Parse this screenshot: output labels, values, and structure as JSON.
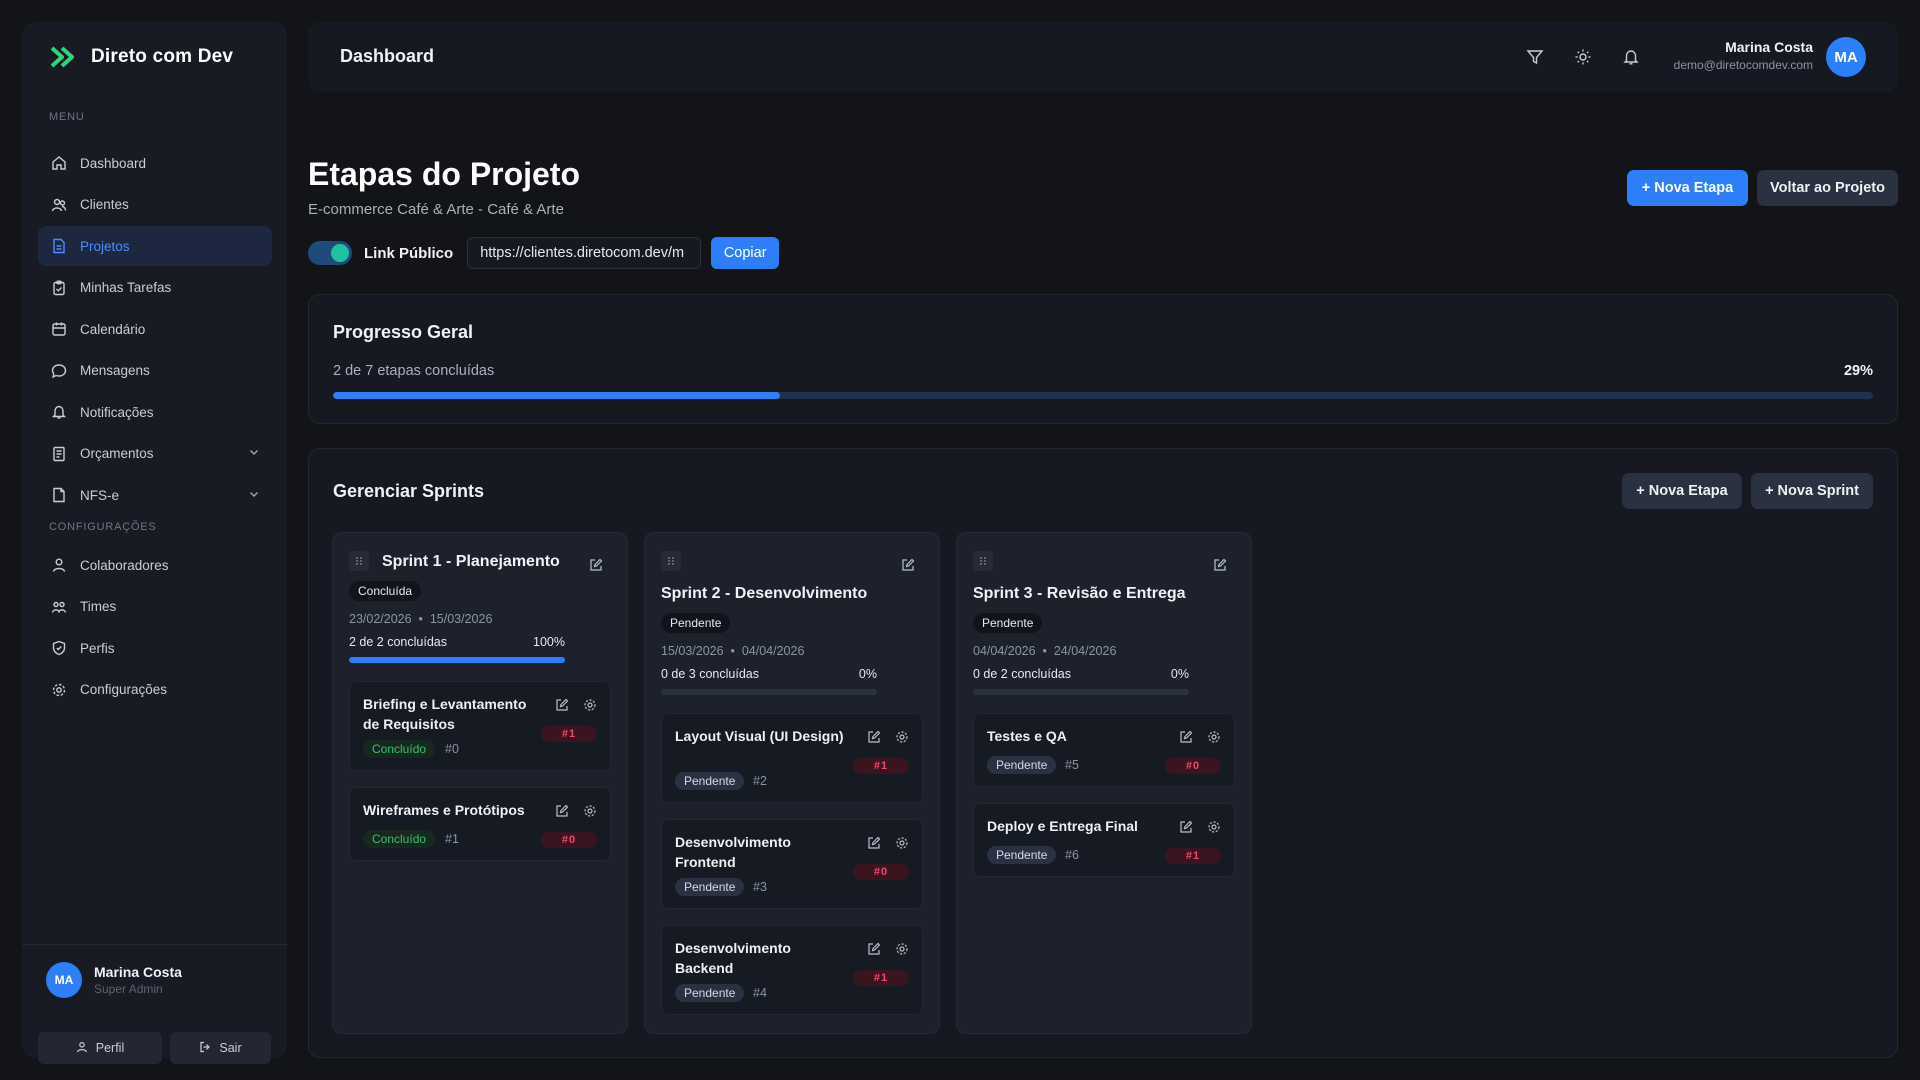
{
  "brand": {
    "name": "Direto com Dev",
    "logo_icon": "double-chevron-logo",
    "accent": "#2bd67b"
  },
  "sidebar": {
    "menu_label": "MENU",
    "items": [
      {
        "label": "Dashboard",
        "icon": "home-icon"
      },
      {
        "label": "Clientes",
        "icon": "users-icon"
      },
      {
        "label": "Projetos",
        "icon": "document-icon",
        "active": true
      },
      {
        "label": "Minhas Tarefas",
        "icon": "clipboard-icon"
      },
      {
        "label": "Calendário",
        "icon": "calendar-icon"
      },
      {
        "label": "Mensagens",
        "icon": "message-icon"
      },
      {
        "label": "Notificações",
        "icon": "bell-icon"
      },
      {
        "label": "Orçamentos",
        "icon": "receipt-icon",
        "expandable": true
      },
      {
        "label": "NFS-e",
        "icon": "file-icon",
        "expandable": true
      }
    ],
    "config_label": "CONFIGURAÇÕES",
    "config_items": [
      {
        "label": "Colaboradores",
        "icon": "user-group-icon"
      },
      {
        "label": "Times",
        "icon": "team-icon"
      },
      {
        "label": "Perfis",
        "icon": "shield-icon"
      },
      {
        "label": "Configurações",
        "icon": "gear-icon"
      }
    ],
    "user": {
      "initials": "MA",
      "name": "Marina Costa",
      "role": "Super Admin"
    },
    "profile_button": "Perfil",
    "logout_button": "Sair"
  },
  "topbar": {
    "title": "Dashboard",
    "user_name": "Marina Costa",
    "user_email": "demo@diretocomdev.com",
    "user_initials": "MA"
  },
  "page": {
    "title": "Etapas do Projeto",
    "subtitle": "E-commerce Café & Arte - Café & Arte",
    "new_stage_button": "+ Nova Etapa",
    "back_button": "Voltar ao Projeto",
    "public_link_label": "Link Público",
    "public_link_value": "https://clientes.diretocom.dev/m",
    "copy_button": "Copiar",
    "public_link_enabled": true
  },
  "progress": {
    "title": "Progresso Geral",
    "summary": "2 de 7 etapas concluídas",
    "percent_label": "29%",
    "fraction": 0.29
  },
  "sprints_section": {
    "title": "Gerenciar Sprints",
    "new_stage_button": "+ Nova Etapa",
    "new_sprint_button": "+ Nova Sprint"
  },
  "sprints": [
    {
      "title": "Sprint 1 - Planejamento",
      "status": "Concluída",
      "start": "23/02/2026",
      "end": "15/03/2026",
      "progress_text": "2 de 2 concluídas",
      "progress_percent": "100%",
      "fraction": 1.0,
      "tasks": [
        {
          "title": "Briefing e Levantamento de Requisitos",
          "status": "Concluído",
          "status_kind": "done",
          "num": "#0",
          "priority": "#1"
        },
        {
          "title": "Wireframes e Protótipos",
          "status": "Concluído",
          "status_kind": "done",
          "num": "#1",
          "priority": "#0"
        }
      ]
    },
    {
      "title": "Sprint 2 - Desenvolvimento",
      "status": "Pendente",
      "start": "15/03/2026",
      "end": "04/04/2026",
      "progress_text": "0 de 3 concluídas",
      "progress_percent": "0%",
      "fraction": 0.0,
      "tasks": [
        {
          "title": "Layout Visual (UI Design)",
          "status": "Pendente",
          "status_kind": "pending",
          "num": "#2",
          "priority": "#1"
        },
        {
          "title": "Desenvolvimento Frontend",
          "status": "Pendente",
          "status_kind": "pending",
          "num": "#3",
          "priority": "#0"
        },
        {
          "title": "Desenvolvimento Backend",
          "status": "Pendente",
          "status_kind": "pending",
          "num": "#4",
          "priority": "#1"
        }
      ]
    },
    {
      "title": "Sprint 3 - Revisão e Entrega",
      "status": "Pendente",
      "start": "04/04/2026",
      "end": "24/04/2026",
      "progress_text": "0 de 2 concluídas",
      "progress_percent": "0%",
      "fraction": 0.0,
      "tasks": [
        {
          "title": "Testes e QA",
          "status": "Pendente",
          "status_kind": "pending",
          "num": "#5",
          "priority": "#0"
        },
        {
          "title": "Deploy e Entrega Final",
          "status": "Pendente",
          "status_kind": "pending",
          "num": "#6",
          "priority": "#1"
        }
      ]
    }
  ]
}
